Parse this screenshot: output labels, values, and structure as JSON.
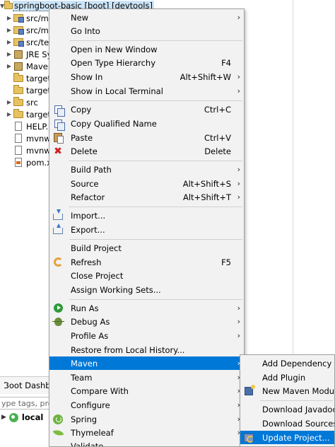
{
  "explorer": {
    "project_label": "springboot-basic [boot] [devtools]",
    "items": [
      {
        "label": "src/ma",
        "icon": "source-folder-icon",
        "expandable": true
      },
      {
        "label": "src/ma",
        "icon": "source-folder-icon",
        "expandable": true
      },
      {
        "label": "src/tes",
        "icon": "source-folder-icon",
        "expandable": true
      },
      {
        "label": "JRE Sy",
        "icon": "library-icon",
        "expandable": true
      },
      {
        "label": "Maven",
        "icon": "library-icon",
        "expandable": true
      },
      {
        "label": "target/",
        "icon": "folder-icon",
        "expandable": false
      },
      {
        "label": "target/",
        "icon": "folder-icon",
        "expandable": false
      },
      {
        "label": "src",
        "icon": "folder-icon",
        "expandable": true
      },
      {
        "label": "target",
        "icon": "folder-icon",
        "expandable": true
      },
      {
        "label": "HELP.n",
        "icon": "file-icon",
        "expandable": false
      },
      {
        "label": "mvnw",
        "icon": "file-icon",
        "expandable": false
      },
      {
        "label": "mvnw",
        "icon": "file-icon",
        "expandable": false
      },
      {
        "label": "pom.x",
        "icon": "xml-file-icon",
        "expandable": false
      }
    ]
  },
  "boot_dashboard": {
    "tab_label": "Boot Dashbo",
    "filter_placeholder": "ype tags, proje",
    "local_label": "local"
  },
  "context_menu": {
    "new": {
      "label": "New",
      "submenu": true
    },
    "go_into": {
      "label": "Go Into"
    },
    "open_new_window": {
      "label": "Open in New Window"
    },
    "open_type_hierarchy": {
      "label": "Open Type Hierarchy",
      "accel": "F4"
    },
    "show_in": {
      "label": "Show In",
      "accel": "Alt+Shift+W",
      "submenu": true
    },
    "show_in_terminal": {
      "label": "Show in Local Terminal",
      "submenu": true
    },
    "copy": {
      "label": "Copy",
      "accel": "Ctrl+C"
    },
    "copy_qualified": {
      "label": "Copy Qualified Name"
    },
    "paste": {
      "label": "Paste",
      "accel": "Ctrl+V"
    },
    "delete": {
      "label": "Delete",
      "accel": "Delete"
    },
    "build_path": {
      "label": "Build Path",
      "submenu": true
    },
    "source": {
      "label": "Source",
      "accel": "Alt+Shift+S",
      "submenu": true
    },
    "refactor": {
      "label": "Refactor",
      "accel": "Alt+Shift+T",
      "submenu": true
    },
    "import": {
      "label": "Import..."
    },
    "export": {
      "label": "Export..."
    },
    "build_project": {
      "label": "Build Project"
    },
    "refresh": {
      "label": "Refresh",
      "accel": "F5"
    },
    "close_project": {
      "label": "Close Project"
    },
    "assign_working_sets": {
      "label": "Assign Working Sets..."
    },
    "run_as": {
      "label": "Run As",
      "submenu": true
    },
    "debug_as": {
      "label": "Debug As",
      "submenu": true
    },
    "profile_as": {
      "label": "Profile As",
      "submenu": true
    },
    "restore_history": {
      "label": "Restore from Local History..."
    },
    "maven": {
      "label": "Maven",
      "submenu": true,
      "highlighted": true
    },
    "team": {
      "label": "Team",
      "submenu": true
    },
    "compare_with": {
      "label": "Compare With",
      "submenu": true
    },
    "configure": {
      "label": "Configure",
      "submenu": true
    },
    "spring": {
      "label": "Spring",
      "submenu": true
    },
    "thymeleaf": {
      "label": "Thymeleaf",
      "submenu": true
    },
    "validate": {
      "label": "Validate"
    },
    "submenu_arrow": "›"
  },
  "maven_submenu": {
    "add_dependency": {
      "label": "Add Dependency"
    },
    "add_plugin": {
      "label": "Add Plugin"
    },
    "new_maven_module": {
      "label": "New Maven Module"
    },
    "download_javadoc": {
      "label": "Download Javadoc"
    },
    "download_sources": {
      "label": "Download Sources"
    },
    "update_project": {
      "label": "Update Project...",
      "highlighted": true
    }
  },
  "colors": {
    "highlight": "#0078d7",
    "menu_background": "#f2f2f2",
    "selection_background": "#cce4f7"
  }
}
